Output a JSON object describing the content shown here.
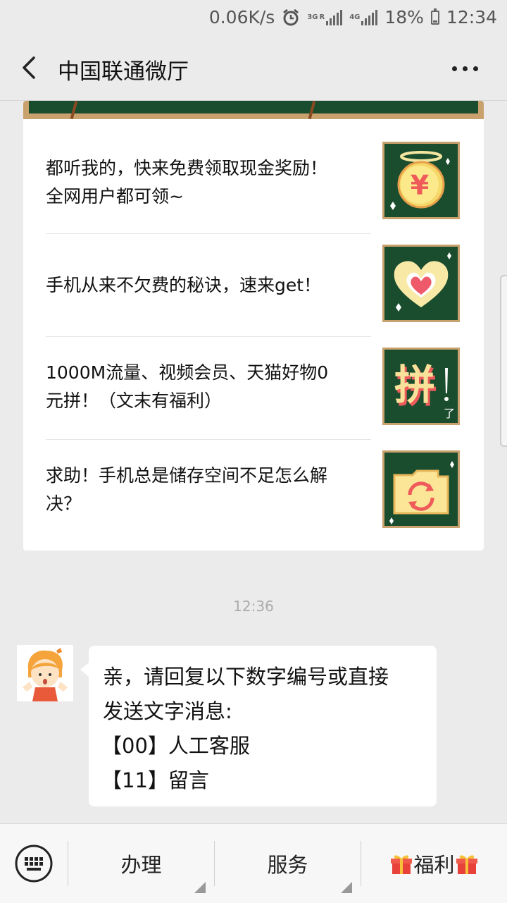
{
  "status_bar": {
    "speed": "0.06K/s",
    "net1": "3G",
    "net1_sub": "R",
    "net2": "4G",
    "battery": "18%",
    "battery_level": 0.18,
    "time": "12:34"
  },
  "header": {
    "title": "中国联通微厅"
  },
  "articles": [
    {
      "title": "都听我的，快来免费领取现金奖励！全网用户都可领~",
      "thumb_icon": "yuan-coin-icon"
    },
    {
      "title": "手机从来不欠费的秘诀，速来get！",
      "thumb_icon": "heart-icon"
    },
    {
      "title": "1000M流量、视频会员、天猫好物0元拼！（文末有福利）",
      "thumb_icon": "pin-text-icon",
      "thumb_text": "拼",
      "thumb_small": "了"
    },
    {
      "title": "求助！手机总是储存空间不足怎么解决？",
      "thumb_icon": "folder-refresh-icon"
    }
  ],
  "chat": {
    "timestamp": "12:36",
    "message_lines": [
      "亲，请回复以下数字编号或直接",
      "发送文字消息:",
      "【00】人工客服",
      "【11】留言"
    ]
  },
  "menu": {
    "items": [
      "办理",
      "服务",
      "福利"
    ]
  },
  "colors": {
    "thumb_bg": "#1a4d2e",
    "thumb_border": "#c9a16c",
    "background": "#ebebeb"
  }
}
